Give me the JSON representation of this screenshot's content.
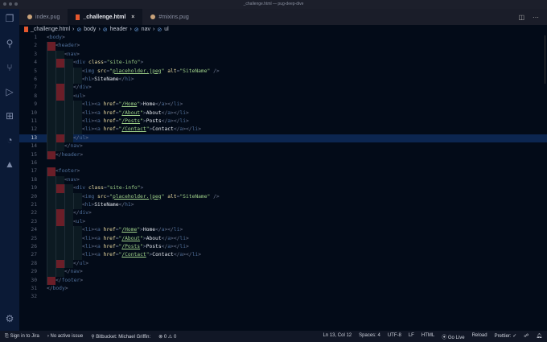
{
  "window": {
    "title": "_challenge.html — pug-deep-dive"
  },
  "tabs": [
    {
      "label": "index.pug",
      "icon": "pug-icon"
    },
    {
      "label": "_challenge.html",
      "icon": "html-icon",
      "active": true
    },
    {
      "label": "#mixins.pug",
      "icon": "pug-icon"
    }
  ],
  "tab_close": "×",
  "breadcrumb": [
    "_challenge.html",
    "body",
    "header",
    "nav",
    "ul"
  ],
  "cursor_line": 13,
  "lines": [
    {
      "i": 0,
      "k": [
        [
          "p",
          "<"
        ],
        [
          "t",
          "body"
        ],
        [
          "p",
          ">"
        ]
      ]
    },
    {
      "i": 1,
      "k": [
        [
          "p",
          "<"
        ],
        [
          "t",
          "header"
        ],
        [
          "p",
          ">"
        ]
      ]
    },
    {
      "i": 2,
      "k": [
        [
          "p",
          "<"
        ],
        [
          "t",
          "nav"
        ],
        [
          "p",
          ">"
        ]
      ]
    },
    {
      "i": 3,
      "k": [
        [
          "p",
          "<"
        ],
        [
          "t",
          "div "
        ],
        [
          "a",
          "class"
        ],
        [
          "p",
          "="
        ],
        [
          "s",
          "\"site-info\""
        ],
        [
          "p",
          ">"
        ]
      ]
    },
    {
      "i": 4,
      "k": [
        [
          "p",
          "<"
        ],
        [
          "t",
          "img "
        ],
        [
          "a",
          "src"
        ],
        [
          "p",
          "="
        ],
        [
          "s",
          "\""
        ],
        [
          "l",
          "placeholder.jpeg"
        ],
        [
          "s",
          "\" "
        ],
        [
          "a",
          "alt"
        ],
        [
          "p",
          "="
        ],
        [
          "s",
          "\"SiteName\""
        ],
        [
          "p",
          " />"
        ]
      ]
    },
    {
      "i": 4,
      "k": [
        [
          "p",
          "<"
        ],
        [
          "t",
          "h1"
        ],
        [
          "p",
          ">"
        ],
        [
          "x",
          "SiteName"
        ],
        [
          "p",
          "</"
        ],
        [
          "t",
          "h1"
        ],
        [
          "p",
          ">"
        ]
      ]
    },
    {
      "i": 3,
      "k": [
        [
          "p",
          "</"
        ],
        [
          "t",
          "div"
        ],
        [
          "p",
          ">"
        ]
      ]
    },
    {
      "i": 3,
      "k": [
        [
          "p",
          "<"
        ],
        [
          "t",
          "ul"
        ],
        [
          "p",
          ">"
        ]
      ]
    },
    {
      "i": 4,
      "k": [
        [
          "p",
          "<"
        ],
        [
          "t",
          "li"
        ],
        [
          "p",
          "><"
        ],
        [
          "t",
          "a "
        ],
        [
          "a",
          "href"
        ],
        [
          "p",
          "="
        ],
        [
          "s",
          "\""
        ],
        [
          "l",
          "/Home"
        ],
        [
          "s",
          "\""
        ],
        [
          "p",
          ">"
        ],
        [
          "x",
          "Home"
        ],
        [
          "p",
          "</"
        ],
        [
          "t",
          "a"
        ],
        [
          "p",
          "></"
        ],
        [
          "t",
          "li"
        ],
        [
          "p",
          ">"
        ]
      ]
    },
    {
      "i": 4,
      "k": [
        [
          "p",
          "<"
        ],
        [
          "t",
          "li"
        ],
        [
          "p",
          "><"
        ],
        [
          "t",
          "a "
        ],
        [
          "a",
          "href"
        ],
        [
          "p",
          "="
        ],
        [
          "s",
          "\""
        ],
        [
          "l",
          "/About"
        ],
        [
          "s",
          "\""
        ],
        [
          "p",
          ">"
        ],
        [
          "x",
          "About"
        ],
        [
          "p",
          "</"
        ],
        [
          "t",
          "a"
        ],
        [
          "p",
          "></"
        ],
        [
          "t",
          "li"
        ],
        [
          "p",
          ">"
        ]
      ]
    },
    {
      "i": 4,
      "k": [
        [
          "p",
          "<"
        ],
        [
          "t",
          "li"
        ],
        [
          "p",
          "><"
        ],
        [
          "t",
          "a "
        ],
        [
          "a",
          "href"
        ],
        [
          "p",
          "="
        ],
        [
          "s",
          "\""
        ],
        [
          "l",
          "/Posts"
        ],
        [
          "s",
          "\""
        ],
        [
          "p",
          ">"
        ],
        [
          "x",
          "Posts"
        ],
        [
          "p",
          "</"
        ],
        [
          "t",
          "a"
        ],
        [
          "p",
          "></"
        ],
        [
          "t",
          "li"
        ],
        [
          "p",
          ">"
        ]
      ]
    },
    {
      "i": 4,
      "k": [
        [
          "p",
          "<"
        ],
        [
          "t",
          "li"
        ],
        [
          "p",
          "><"
        ],
        [
          "t",
          "a "
        ],
        [
          "a",
          "href"
        ],
        [
          "p",
          "="
        ],
        [
          "s",
          "\""
        ],
        [
          "l",
          "/Contact"
        ],
        [
          "s",
          "\""
        ],
        [
          "p",
          ">"
        ],
        [
          "x",
          "Contact"
        ],
        [
          "p",
          "</"
        ],
        [
          "t",
          "a"
        ],
        [
          "p",
          "></"
        ],
        [
          "t",
          "li"
        ],
        [
          "p",
          ">"
        ]
      ]
    },
    {
      "i": 3,
      "k": [
        [
          "p",
          "</"
        ],
        [
          "t",
          "ul"
        ],
        [
          "p",
          ">"
        ]
      ]
    },
    {
      "i": 2,
      "k": [
        [
          "p",
          "</"
        ],
        [
          "t",
          "nav"
        ],
        [
          "p",
          ">"
        ]
      ]
    },
    {
      "i": 1,
      "k": [
        [
          "p",
          "</"
        ],
        [
          "t",
          "header"
        ],
        [
          "p",
          ">"
        ]
      ]
    },
    {
      "i": 0,
      "k": []
    },
    {
      "i": 1,
      "k": [
        [
          "p",
          "<"
        ],
        [
          "t",
          "footer"
        ],
        [
          "p",
          ">"
        ]
      ]
    },
    {
      "i": 2,
      "k": [
        [
          "p",
          "<"
        ],
        [
          "t",
          "nav"
        ],
        [
          "p",
          ">"
        ]
      ]
    },
    {
      "i": 3,
      "k": [
        [
          "p",
          "<"
        ],
        [
          "t",
          "div "
        ],
        [
          "a",
          "class"
        ],
        [
          "p",
          "="
        ],
        [
          "s",
          "\"site-info\""
        ],
        [
          "p",
          ">"
        ]
      ]
    },
    {
      "i": 4,
      "k": [
        [
          "p",
          "<"
        ],
        [
          "t",
          "img "
        ],
        [
          "a",
          "src"
        ],
        [
          "p",
          "="
        ],
        [
          "s",
          "\""
        ],
        [
          "l",
          "placeholder.jpeg"
        ],
        [
          "s",
          "\" "
        ],
        [
          "a",
          "alt"
        ],
        [
          "p",
          "="
        ],
        [
          "s",
          "\"SiteName\""
        ],
        [
          "p",
          " />"
        ]
      ]
    },
    {
      "i": 4,
      "k": [
        [
          "p",
          "<"
        ],
        [
          "t",
          "h1"
        ],
        [
          "p",
          ">"
        ],
        [
          "x",
          "SiteName"
        ],
        [
          "p",
          "</"
        ],
        [
          "t",
          "h1"
        ],
        [
          "p",
          ">"
        ]
      ]
    },
    {
      "i": 3,
      "k": [
        [
          "p",
          "</"
        ],
        [
          "t",
          "div"
        ],
        [
          "p",
          ">"
        ]
      ]
    },
    {
      "i": 3,
      "k": [
        [
          "p",
          "<"
        ],
        [
          "t",
          "ul"
        ],
        [
          "p",
          ">"
        ]
      ]
    },
    {
      "i": 4,
      "k": [
        [
          "p",
          "<"
        ],
        [
          "t",
          "li"
        ],
        [
          "p",
          "><"
        ],
        [
          "t",
          "a "
        ],
        [
          "a",
          "href"
        ],
        [
          "p",
          "="
        ],
        [
          "s",
          "\""
        ],
        [
          "l",
          "/Home"
        ],
        [
          "s",
          "\""
        ],
        [
          "p",
          ">"
        ],
        [
          "x",
          "Home"
        ],
        [
          "p",
          "</"
        ],
        [
          "t",
          "a"
        ],
        [
          "p",
          "></"
        ],
        [
          "t",
          "li"
        ],
        [
          "p",
          ">"
        ]
      ]
    },
    {
      "i": 4,
      "k": [
        [
          "p",
          "<"
        ],
        [
          "t",
          "li"
        ],
        [
          "p",
          "><"
        ],
        [
          "t",
          "a "
        ],
        [
          "a",
          "href"
        ],
        [
          "p",
          "="
        ],
        [
          "s",
          "\""
        ],
        [
          "l",
          "/About"
        ],
        [
          "s",
          "\""
        ],
        [
          "p",
          ">"
        ],
        [
          "x",
          "About"
        ],
        [
          "p",
          "</"
        ],
        [
          "t",
          "a"
        ],
        [
          "p",
          "></"
        ],
        [
          "t",
          "li"
        ],
        [
          "p",
          ">"
        ]
      ]
    },
    {
      "i": 4,
      "k": [
        [
          "p",
          "<"
        ],
        [
          "t",
          "li"
        ],
        [
          "p",
          "><"
        ],
        [
          "t",
          "a "
        ],
        [
          "a",
          "href"
        ],
        [
          "p",
          "="
        ],
        [
          "s",
          "\""
        ],
        [
          "l",
          "/Posts"
        ],
        [
          "s",
          "\""
        ],
        [
          "p",
          ">"
        ],
        [
          "x",
          "Posts"
        ],
        [
          "p",
          "</"
        ],
        [
          "t",
          "a"
        ],
        [
          "p",
          "></"
        ],
        [
          "t",
          "li"
        ],
        [
          "p",
          ">"
        ]
      ]
    },
    {
      "i": 4,
      "k": [
        [
          "p",
          "<"
        ],
        [
          "t",
          "li"
        ],
        [
          "p",
          "><"
        ],
        [
          "t",
          "a "
        ],
        [
          "a",
          "href"
        ],
        [
          "p",
          "="
        ],
        [
          "s",
          "\""
        ],
        [
          "l",
          "/Contact"
        ],
        [
          "s",
          "\""
        ],
        [
          "p",
          ">"
        ],
        [
          "x",
          "Contact"
        ],
        [
          "p",
          "</"
        ],
        [
          "t",
          "a"
        ],
        [
          "p",
          "></"
        ],
        [
          "t",
          "li"
        ],
        [
          "p",
          ">"
        ]
      ]
    },
    {
      "i": 3,
      "k": [
        [
          "p",
          "</"
        ],
        [
          "t",
          "ul"
        ],
        [
          "p",
          ">"
        ]
      ]
    },
    {
      "i": 2,
      "k": [
        [
          "p",
          "</"
        ],
        [
          "t",
          "nav"
        ],
        [
          "p",
          ">"
        ]
      ]
    },
    {
      "i": 1,
      "k": [
        [
          "p",
          "</"
        ],
        [
          "t",
          "footer"
        ],
        [
          "p",
          ">"
        ]
      ]
    },
    {
      "i": 0,
      "k": [
        [
          "p",
          "</"
        ],
        [
          "t",
          "body"
        ],
        [
          "p",
          ">"
        ]
      ]
    },
    {
      "i": 0,
      "k": []
    }
  ],
  "status": {
    "jira": "Sign in to Jira",
    "issue": "No active issue",
    "bitbucket": "Bitbucket: Michael Griffin:",
    "errors": "0",
    "warnings": "0",
    "position": "Ln 13, Col 12",
    "spaces": "Spaces: 4",
    "encoding": "UTF-8",
    "eol": "LF",
    "language": "HTML",
    "golive": "Go Live",
    "reload": "Reload",
    "prettier": "Prettier: ✓"
  }
}
